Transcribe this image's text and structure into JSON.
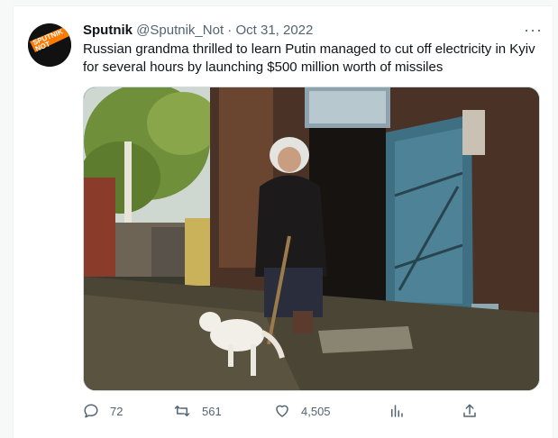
{
  "tweet": {
    "display_name": "Sputnik",
    "handle": "@Sputnik_Not",
    "separator": "·",
    "date": "Oct 31, 2022",
    "more_label": "···",
    "text": "Russian grandma thrilled to learn Putin managed to cut off electricity in Kyiv for several hours by launching $500 million worth of missiles",
    "avatar": {
      "brand_lines": [
        "SPUTNIK",
        "NOT"
      ],
      "colors": {
        "bg": "#111111",
        "accent": "#ff7a00"
      }
    },
    "media": {
      "icon": "photo-image"
    }
  },
  "actions": {
    "reply": {
      "icon": "reply-icon",
      "count": "72"
    },
    "retweet": {
      "icon": "retweet-icon",
      "count": "561"
    },
    "like": {
      "icon": "heart-icon",
      "count": "4,505"
    },
    "views": {
      "icon": "analytics-icon"
    },
    "share": {
      "icon": "share-icon"
    }
  },
  "colors": {
    "text_primary": "#0f1419",
    "text_secondary": "#536471",
    "border": "#cfd9de",
    "page_bg": "#f7f9f9"
  }
}
